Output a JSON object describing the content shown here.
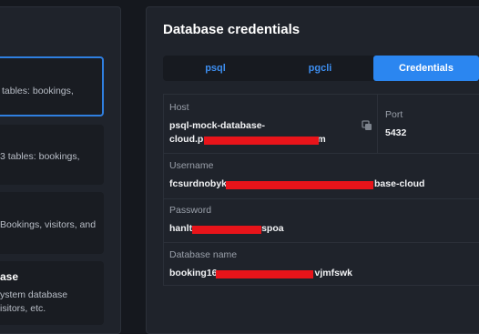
{
  "left_cards": [
    {
      "text_lines": [
        "tables: bookings,",
        "..."
      ]
    },
    {
      "text_lines": [
        "3 tables: bookings,",
        "..."
      ]
    },
    {
      "text_lines": [
        "Bookings, visitors, and",
        "..."
      ]
    },
    {
      "title": "ase",
      "text_lines": [
        "ystem database",
        "isitors, etc."
      ]
    }
  ],
  "panel": {
    "title": "Database credentials",
    "tabs": [
      {
        "label": "psql",
        "active": false
      },
      {
        "label": "pgcli",
        "active": false
      },
      {
        "label": "Credentials",
        "active": true
      }
    ]
  },
  "credentials": {
    "host_label": "Host",
    "host_value_line1": "psql-mock-database-",
    "host_value_line2_start": "cloud.p",
    "host_value_line2_end": "m",
    "copy_icon": "copy-icon",
    "port_label": "Port",
    "port_value": "5432",
    "username_label": "Username",
    "username_value_start": "fcsurdnobyk",
    "username_value_end": "base-cloud",
    "password_label": "Password",
    "password_value_start": "hanlt",
    "password_value_end": "spoa",
    "dbname_label": "Database name",
    "dbname_value_start": "booking16",
    "dbname_value_end": "vjmfswk"
  },
  "colors": {
    "accent": "#2b86f0",
    "redaction": "#e8141a",
    "selected_border": "#2f7fe0"
  }
}
